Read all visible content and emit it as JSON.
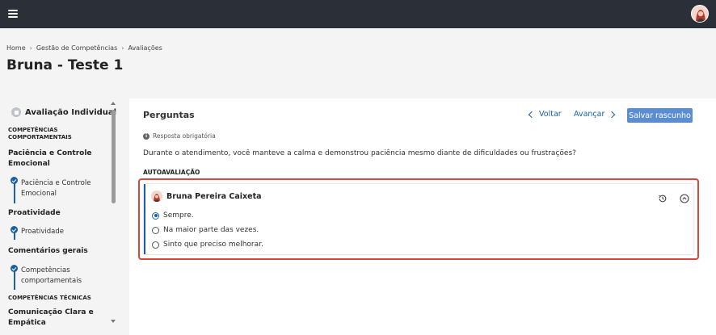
{
  "breadcrumb": [
    "Home",
    "Gestão de Competências",
    "Avaliações"
  ],
  "page": {
    "title": "Bruna - Teste 1"
  },
  "sidebar": {
    "header": "Avaliação Individual",
    "sections": [
      {
        "label": "COMPETÊNCIAS COMPORTAMENTAIS"
      },
      {
        "label": "COMPETÊNCIAS TÉCNICAS"
      }
    ],
    "groups": [
      {
        "label": "Paciência e Controle Emocional",
        "item": "Paciência e Controle Emocional"
      },
      {
        "label": "Proatividade",
        "item": "Proatividade"
      },
      {
        "label": "Comentários gerais",
        "item": "Competências comportamentais"
      },
      {
        "label": "Comunicação Clara e Empática"
      }
    ]
  },
  "main": {
    "title": "Perguntas",
    "back_label": "Voltar",
    "next_label": "Avançar",
    "save_label": "Salvar rascunho",
    "required_text": "Resposta obrigatória",
    "question": "Durante o atendimento, você manteve a calma e demonstrou paciência mesmo diante de dificuldades ou frustrações?",
    "section_label": "AUTOAVALIAÇÃO",
    "answer": {
      "user_name": "Bruna Pereira Caixeta",
      "options": [
        "Sempre.",
        "Na maior parte das vezes.",
        "Sinto que preciso melhorar."
      ],
      "selected_index": 0
    }
  },
  "colors": {
    "topbar": "#2b2f38",
    "accent": "#1a5fa8",
    "save_button": "#5b8ed0",
    "highlight_border": "#d9463b"
  },
  "icons": [
    "hamburger-icon",
    "avatar",
    "info-icon",
    "chevron-left-icon",
    "chevron-right-icon",
    "history-icon",
    "collapse-icon",
    "check-icon"
  ]
}
